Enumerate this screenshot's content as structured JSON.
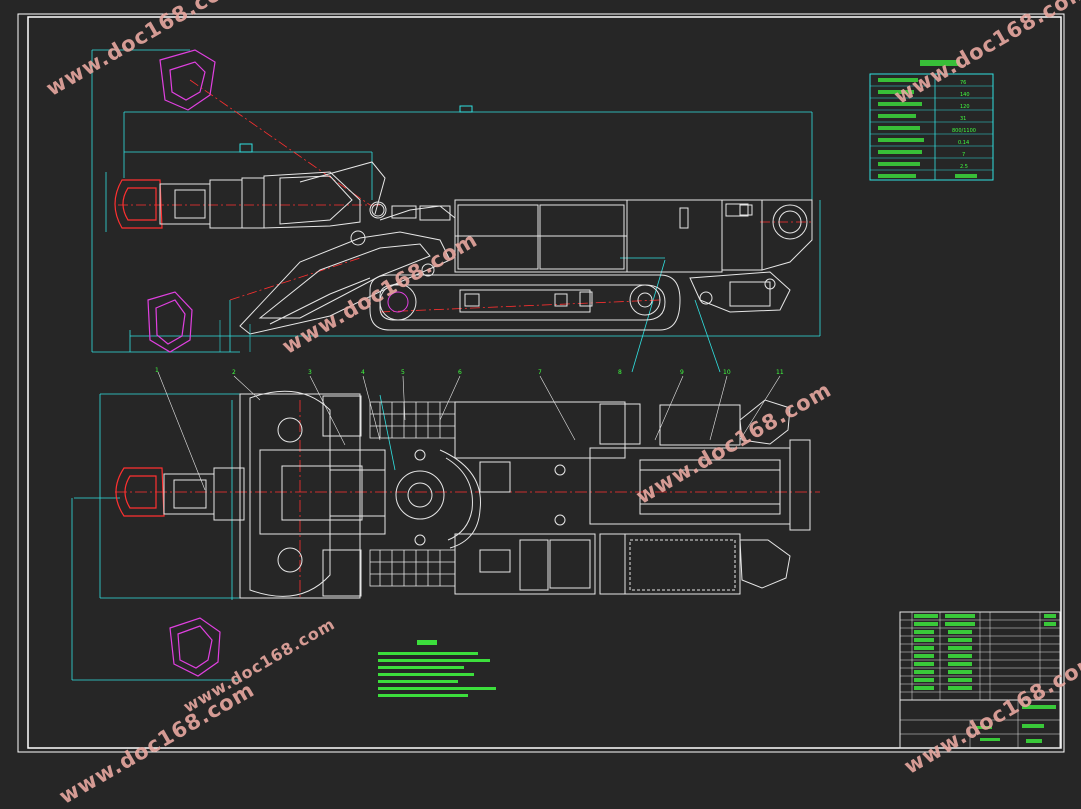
{
  "watermark": {
    "text": "www.doc168.com"
  },
  "colors": {
    "background": "#262626",
    "frame": "#ffffff",
    "linework": "#e6e6e6",
    "centerline": "#ff3030",
    "dimension": "#30e0e0",
    "cutter_head": "#e040e0",
    "annotation": "#40ff40",
    "watermark": "#e8a8a0"
  },
  "tech_params_table": {
    "rows": [
      {
        "label": "",
        "value": "76"
      },
      {
        "label": "",
        "value": "140"
      },
      {
        "label": "",
        "value": "120"
      },
      {
        "label": "",
        "value": "31"
      },
      {
        "label": "",
        "value": "800/1100"
      },
      {
        "label": "",
        "value": "0.14"
      },
      {
        "label": "",
        "value": "7"
      },
      {
        "label": "",
        "value": "2.5"
      },
      {
        "label": "",
        "value": ""
      }
    ]
  },
  "balloons": [
    "1",
    "2",
    "3",
    "4",
    "5",
    "6",
    "7",
    "8",
    "9",
    "10",
    "11"
  ]
}
